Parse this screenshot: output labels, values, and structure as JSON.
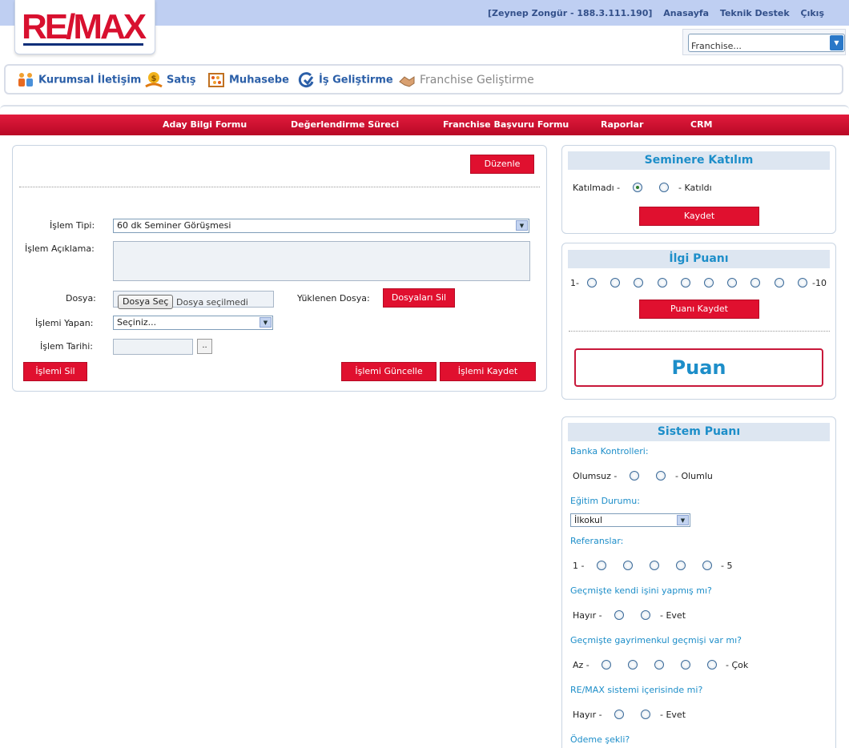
{
  "header": {
    "logo_text": "RE/MAX",
    "user": "[Zeynep Zongür - 188.3.111.190]",
    "links": [
      "Anasayfa",
      "Teknik Destek",
      "Çıkış"
    ],
    "franchise_select": "Franchise..."
  },
  "modules": [
    "Kurumsal İletişim",
    "Satış",
    "Muhasebe",
    "İş Geliştirme",
    "Franchise Geliştirme"
  ],
  "nav": [
    "Aday Bilgi Formu",
    "Değerlendirme Süreci",
    "Franchise Başvuru Formu",
    "Raporlar",
    "CRM"
  ],
  "form": {
    "edit_button": "Düzenle",
    "islem_tipi_label": "İşlem Tipi:",
    "islem_tipi_value": "60 dk Seminer Görüşmesi",
    "islem_aciklama_label": "İşlem Açıklama:",
    "dosya_label": "Dosya:",
    "file_button": "Dosya Seç",
    "file_status": "Dosya seçilmedi",
    "yuklenen_label": "Yüklenen Dosya:",
    "delete_files_button": "Dosyaları Sil",
    "islemi_yapan_label": "İşlemi Yapan:",
    "islemi_yapan_value": "Seçiniz...",
    "islem_tarihi_label": "İşlem Tarihi:",
    "date_button": "..",
    "delete_button": "İşlemi Sil",
    "update_button": "İşlemi Güncelle",
    "save_button": "İşlemi Kaydet"
  },
  "seminer": {
    "title": "Seminere Katılım",
    "left": "Katılmadı -",
    "right": "- Katıldı",
    "selected": "left",
    "save": "Kaydet"
  },
  "ilgi": {
    "title": "İlgi Puanı",
    "min": "1-",
    "max": "-10",
    "count": 10,
    "save": "Puanı Kaydet",
    "puan": "Puan"
  },
  "sistem": {
    "title": "Sistem Puanı",
    "banka_label": "Banka Kontrolleri:",
    "banka_left": "Olumsuz -",
    "banka_right": "- Olumlu",
    "egitim_label": "Eğitim Durumu:",
    "egitim_value": "İlkokul",
    "referans_label": "Referanslar:",
    "referans_left": "1 -",
    "referans_right": "- 5",
    "kendi_label": "Geçmişte kendi işini yapmış mı?",
    "kendi_left": "Hayır -",
    "kendi_right": "- Evet",
    "gayrimenkul_label": "Geçmişte gayrimenkul geçmişi var mı?",
    "gayrimenkul_left": "Az -",
    "gayrimenkul_right": "- Çok",
    "remax_label": "RE/MAX sistemi içerisinde mi?",
    "remax_left": "Hayır -",
    "remax_right": "- Evet",
    "odeme_label": "Ödeme şekli?"
  },
  "colors": {
    "brand_red": "#e0102f",
    "brand_blue": "#1d8ec9",
    "top_bar": "#bfcff2"
  }
}
